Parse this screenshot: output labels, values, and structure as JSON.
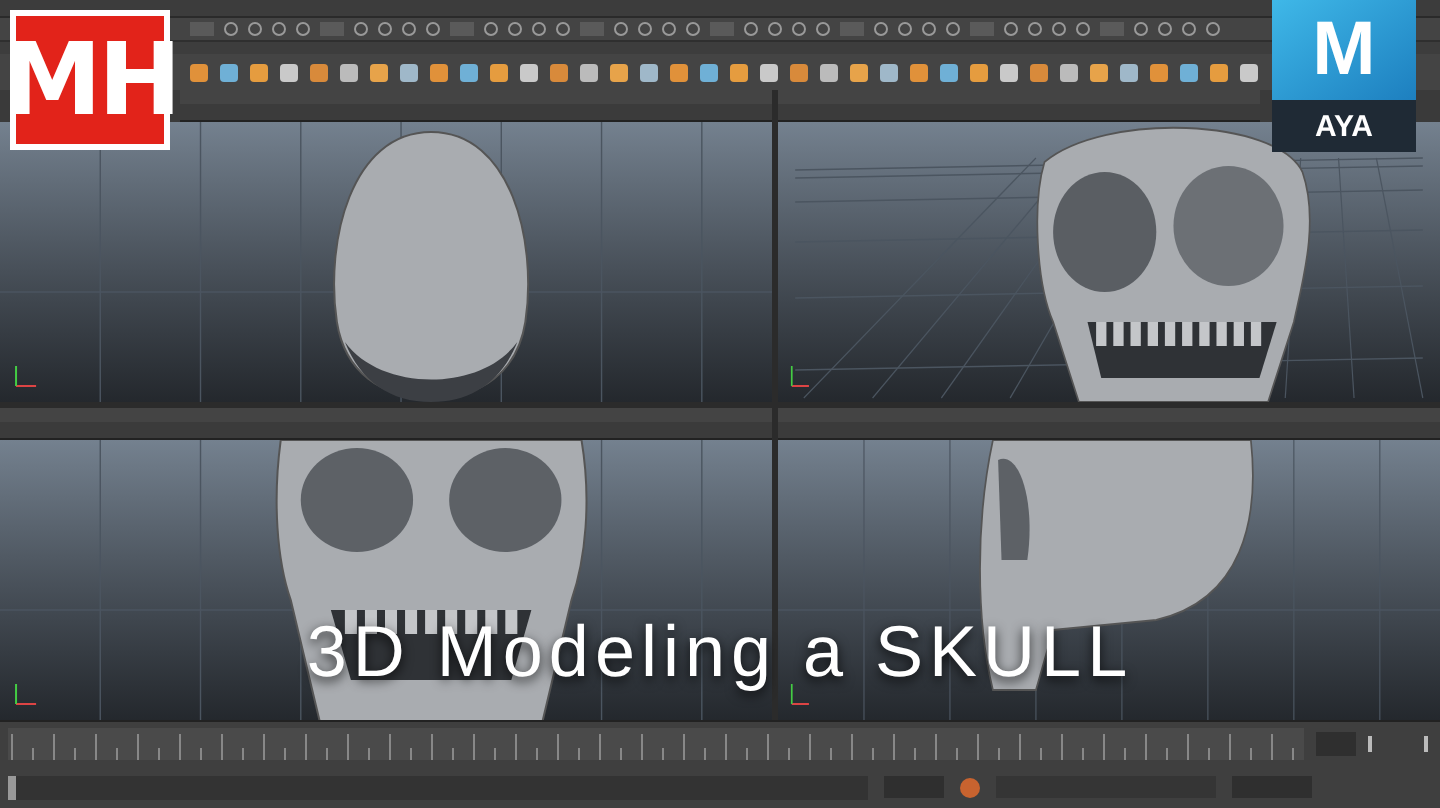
{
  "channel_logo": {
    "text": "MH"
  },
  "app_logo": {
    "letter": "M",
    "label": "AYA"
  },
  "viewports": [
    {
      "kind": "back"
    },
    {
      "kind": "perspective"
    },
    {
      "kind": "front"
    },
    {
      "kind": "side"
    }
  ],
  "title": "3D Modeling a SKULL",
  "timeline": {
    "range_slider": {
      "level": 1
    }
  }
}
